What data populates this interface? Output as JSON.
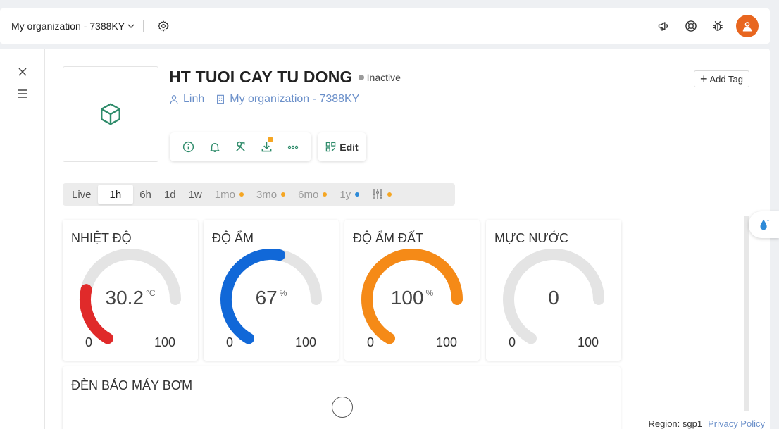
{
  "topbar": {
    "org_name": "My organization - 7388KY",
    "icons": [
      "chevron-down-icon",
      "gear-icon",
      "megaphone-icon",
      "lifebuoy-icon",
      "bug-icon",
      "avatar"
    ]
  },
  "device": {
    "title": "HT TUOI CAY TU DONG",
    "status": "Inactive",
    "owner": "Linh",
    "organization": "My organization - 7388KY",
    "add_tag_label": "Add Tag",
    "edit_label": "Edit"
  },
  "time_ranges": [
    {
      "label": "Live",
      "state": "normal"
    },
    {
      "label": "1h",
      "state": "active"
    },
    {
      "label": "6h",
      "state": "normal"
    },
    {
      "label": "1d",
      "state": "normal"
    },
    {
      "label": "1w",
      "state": "normal"
    },
    {
      "label": "1mo",
      "state": "dim",
      "dot": "#f5a623"
    },
    {
      "label": "3mo",
      "state": "dim",
      "dot": "#f5a623"
    },
    {
      "label": "6mo",
      "state": "dim",
      "dot": "#f5a623"
    },
    {
      "label": "1y",
      "state": "dim",
      "dot": "#2d8ad8"
    }
  ],
  "gauges": [
    {
      "title": "NHIỆT ĐỘ",
      "value": "30.2",
      "unit": "°C",
      "min": "0",
      "max": "100",
      "fraction": 0.302,
      "color": "#e02a2a"
    },
    {
      "title": "ĐỘ ẨM",
      "value": "67",
      "unit": "%",
      "min": "0",
      "max": "100",
      "fraction": 0.67,
      "color": "#1168d8"
    },
    {
      "title": "ĐỘ ẨM ĐẤT",
      "value": "100",
      "unit": "%",
      "min": "0",
      "max": "100",
      "fraction": 1.0,
      "color": "#f58a17"
    },
    {
      "title": "MỰC NƯỚC",
      "value": "0",
      "unit": "",
      "min": "0",
      "max": "100",
      "fraction": 0.0,
      "color": "#d8d8d8"
    }
  ],
  "pump": {
    "title": "ĐÈN BÁO MÁY BƠM"
  },
  "footer": {
    "region": "Region: sgp1",
    "privacy": "Privacy Policy"
  },
  "colors": {
    "accent_green": "#2e8b6a",
    "link_blue": "#6a8fc9",
    "track_gray": "#e4e4e4"
  }
}
